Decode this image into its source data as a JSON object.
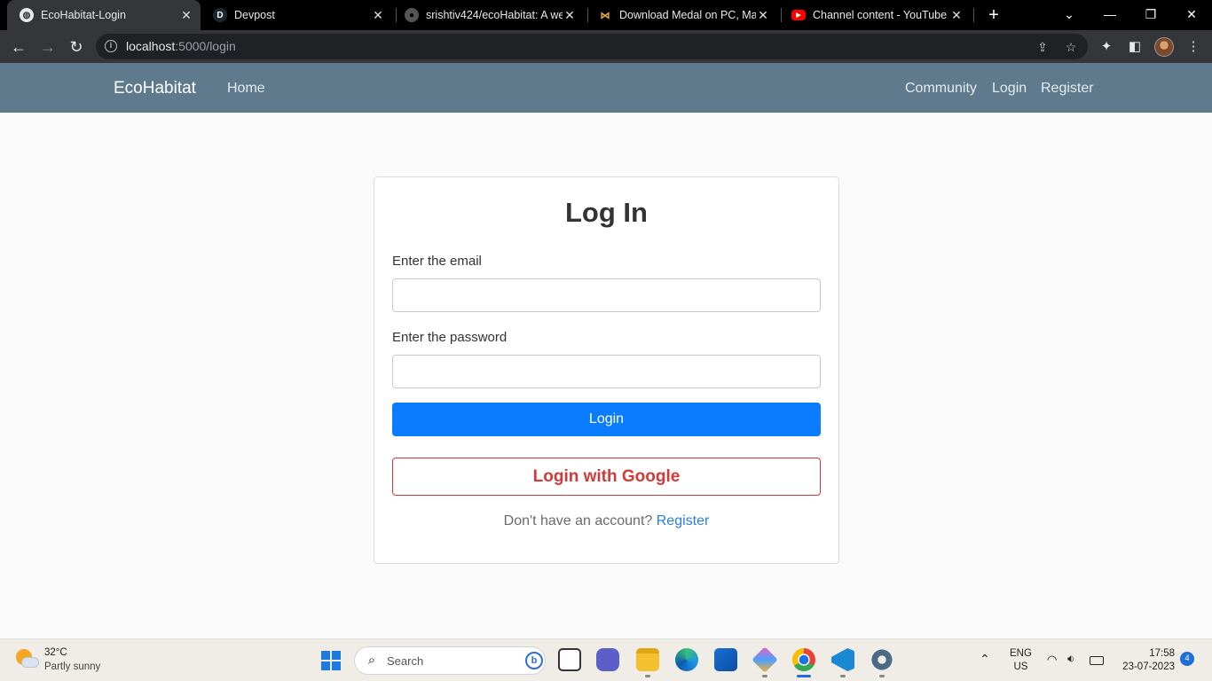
{
  "browser": {
    "tabs": [
      {
        "title": "EcoHabitat-Login",
        "active": true
      },
      {
        "title": "Devpost",
        "favicon_letter": "D"
      },
      {
        "title": "srishtiv424/ecoHabitat: A wel"
      },
      {
        "title": "Download Medal on PC, Mac"
      },
      {
        "title": "Channel content - YouTube S"
      }
    ],
    "url_host": "localhost",
    "url_path": ":5000/login"
  },
  "site": {
    "brand": "EcoHabitat",
    "nav_left": [
      "Home"
    ],
    "nav_right": [
      "Community",
      "Login",
      "Register"
    ]
  },
  "login": {
    "title": "Log In",
    "email_label": "Enter the email",
    "email_value": "",
    "password_label": "Enter the password",
    "password_value": "",
    "login_button": "Login",
    "google_button": "Login with Google",
    "signup_prompt": "Don't have an account?",
    "signup_link": "Register"
  },
  "taskbar": {
    "temperature": "32°C",
    "condition": "Partly sunny",
    "search_label": "Search",
    "language": "ENG",
    "region": "US",
    "time": "17:58",
    "date": "23-07-2023",
    "notifications": "4"
  },
  "colors": {
    "navbar": "#5f7a8c",
    "primary_button": "#0a7cff",
    "google_accent": "#d23a3a",
    "link": "#2b7de0"
  }
}
